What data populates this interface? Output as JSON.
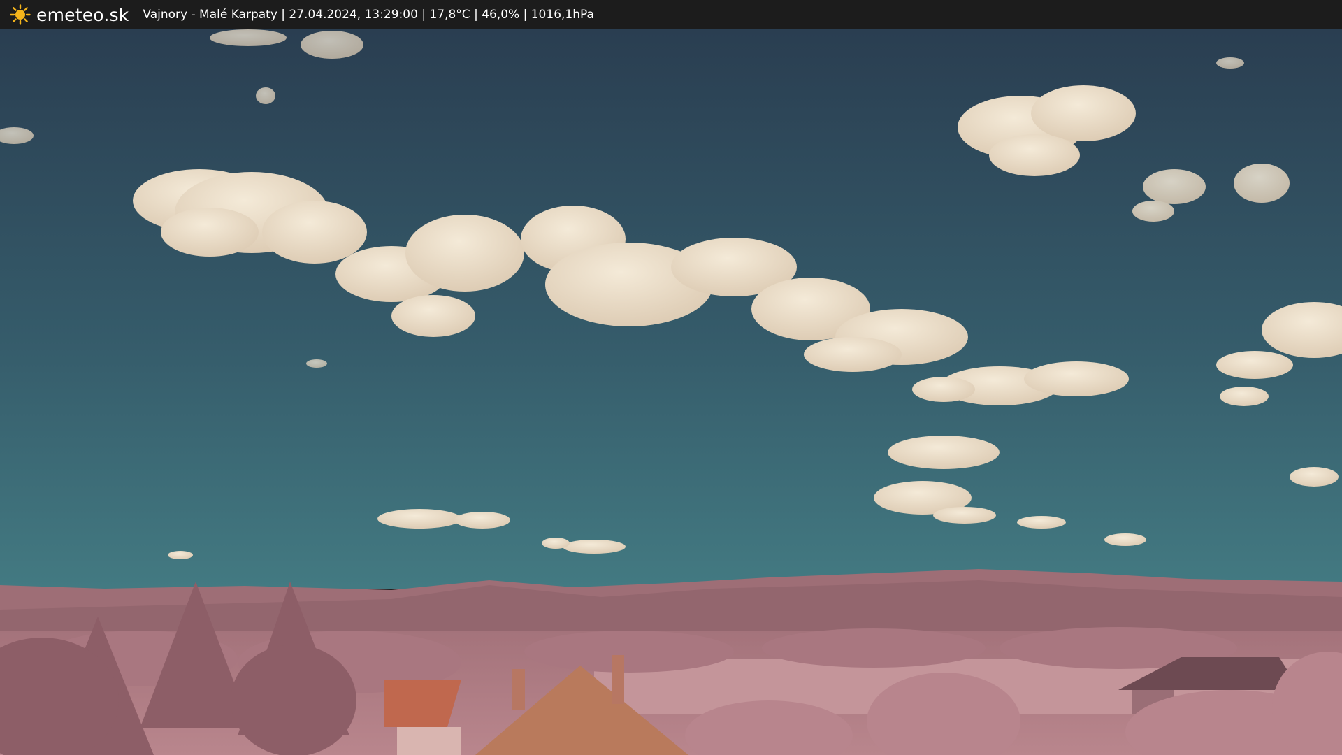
{
  "header": {
    "brand": "emeteo.sk",
    "caption": "Vajnory - Malé Karpaty | 27.04.2024, 13:29:00 | 17,8°C | 46,0% | 1016,1hPa",
    "sun_icon": "sun-icon",
    "sun_color": "#f5b51b",
    "bar_color": "#1c1c1c"
  },
  "scene": {
    "sky_top": "#2a3f52",
    "sky_bottom": "#3d6e78",
    "cloud_color": "#efe3cf",
    "hills_color": "#a2727a",
    "foliage_color": "#b27e86",
    "roof_color": "#c0684e"
  }
}
